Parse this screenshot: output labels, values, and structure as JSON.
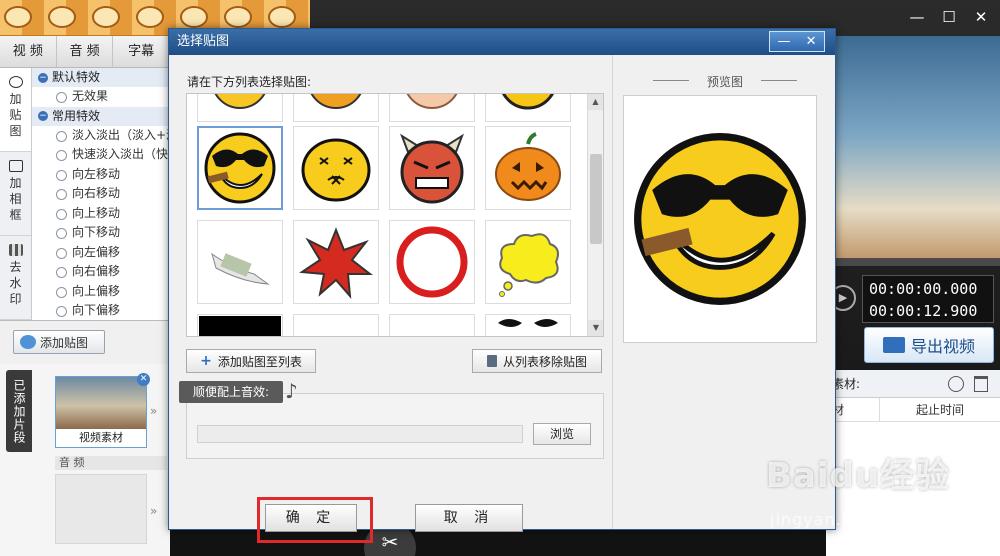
{
  "window": {
    "minimize": "—",
    "maximize": "☐",
    "close": "✕"
  },
  "tabs": [
    "视 频",
    "音 频",
    "字幕"
  ],
  "side_tabs": [
    {
      "label": "加\n贴\n图"
    },
    {
      "label": "加\n相\n框"
    },
    {
      "label": "去\n水\n印"
    }
  ],
  "effects": {
    "default_group": "默认特效",
    "default_items": [
      "无效果"
    ],
    "common_group": "常用特效",
    "common_items": [
      "淡入淡出（淡入+淡",
      "快速淡入淡出（快",
      "向左移动",
      "向右移动",
      "向上移动",
      "向下移动",
      "向左偏移",
      "向右偏移",
      "向上偏移",
      "向下偏移"
    ]
  },
  "add_sticker_button": "添加贴图",
  "clips_label": "已添加片段",
  "clip_thumb_label": "视频素材",
  "audio_label": "音 频",
  "preview": {
    "progress": 0.02,
    "time_current": "00:00:00.000",
    "time_total": "00:00:12.900"
  },
  "export_button": "导出视频",
  "material_panel": {
    "title": "素材:",
    "col_material": "材",
    "col_start_time": "起止时间"
  },
  "dialog": {
    "title": "选择贴图",
    "minimize": "—",
    "close": "✕",
    "list_label": "请在下方列表选择贴图:",
    "add_to_list": "添加贴图至列表",
    "remove_from_list": "从列表移除贴图",
    "sound_label": "顺便配上音效:",
    "browse": "浏览",
    "ok": "确 定",
    "cancel": "取 消",
    "preview_label": "预览图"
  },
  "stickers": [
    {
      "name": "sticker-smiley-partial",
      "row": 0,
      "col": 0
    },
    {
      "name": "sticker-orange-face-partial",
      "row": 0,
      "col": 1
    },
    {
      "name": "sticker-peach-face-partial",
      "row": 0,
      "col": 2
    },
    {
      "name": "sticker-yellow-face-partial",
      "row": 0,
      "col": 3
    },
    {
      "name": "sticker-sunglasses-cigar",
      "row": 1,
      "col": 0,
      "selected": true
    },
    {
      "name": "sticker-puffed-face",
      "row": 1,
      "col": 1
    },
    {
      "name": "sticker-devil-face",
      "row": 1,
      "col": 2
    },
    {
      "name": "sticker-pumpkin",
      "row": 1,
      "col": 3
    },
    {
      "name": "sticker-banknotes",
      "row": 2,
      "col": 0
    },
    {
      "name": "sticker-red-burst",
      "row": 2,
      "col": 1
    },
    {
      "name": "sticker-red-ring",
      "row": 2,
      "col": 2
    },
    {
      "name": "sticker-yellow-cloud",
      "row": 2,
      "col": 3
    },
    {
      "name": "sticker-black-bar",
      "row": 3,
      "col": 0
    },
    {
      "name": "sticker-empty",
      "row": 3,
      "col": 1
    },
    {
      "name": "sticker-empty",
      "row": 3,
      "col": 2
    },
    {
      "name": "sticker-mustache",
      "row": 3,
      "col": 3
    }
  ],
  "watermark": {
    "text": "Baidu经验",
    "url": "jingyan.baidu.com"
  },
  "colors": {
    "highlight": "#e0292b",
    "title_bar": "#2f68ae"
  }
}
